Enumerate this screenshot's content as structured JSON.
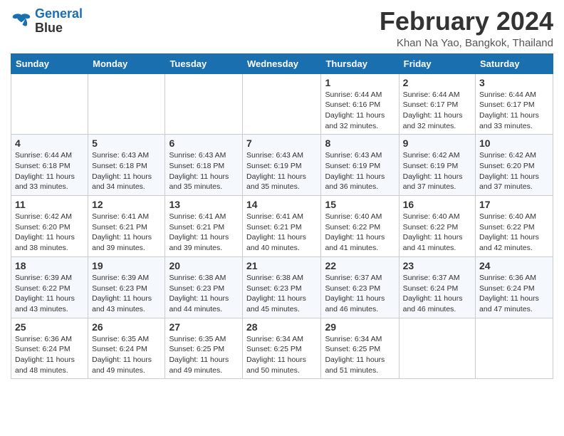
{
  "header": {
    "logo_line1": "General",
    "logo_line2": "Blue",
    "title": "February 2024",
    "subtitle": "Khan Na Yao, Bangkok, Thailand"
  },
  "days_of_week": [
    "Sunday",
    "Monday",
    "Tuesday",
    "Wednesday",
    "Thursday",
    "Friday",
    "Saturday"
  ],
  "weeks": [
    [
      {
        "day": "",
        "info": ""
      },
      {
        "day": "",
        "info": ""
      },
      {
        "day": "",
        "info": ""
      },
      {
        "day": "",
        "info": ""
      },
      {
        "day": "1",
        "info": "Sunrise: 6:44 AM\nSunset: 6:16 PM\nDaylight: 11 hours and 32 minutes."
      },
      {
        "day": "2",
        "info": "Sunrise: 6:44 AM\nSunset: 6:17 PM\nDaylight: 11 hours and 32 minutes."
      },
      {
        "day": "3",
        "info": "Sunrise: 6:44 AM\nSunset: 6:17 PM\nDaylight: 11 hours and 33 minutes."
      }
    ],
    [
      {
        "day": "4",
        "info": "Sunrise: 6:44 AM\nSunset: 6:18 PM\nDaylight: 11 hours and 33 minutes."
      },
      {
        "day": "5",
        "info": "Sunrise: 6:43 AM\nSunset: 6:18 PM\nDaylight: 11 hours and 34 minutes."
      },
      {
        "day": "6",
        "info": "Sunrise: 6:43 AM\nSunset: 6:18 PM\nDaylight: 11 hours and 35 minutes."
      },
      {
        "day": "7",
        "info": "Sunrise: 6:43 AM\nSunset: 6:19 PM\nDaylight: 11 hours and 35 minutes."
      },
      {
        "day": "8",
        "info": "Sunrise: 6:43 AM\nSunset: 6:19 PM\nDaylight: 11 hours and 36 minutes."
      },
      {
        "day": "9",
        "info": "Sunrise: 6:42 AM\nSunset: 6:19 PM\nDaylight: 11 hours and 37 minutes."
      },
      {
        "day": "10",
        "info": "Sunrise: 6:42 AM\nSunset: 6:20 PM\nDaylight: 11 hours and 37 minutes."
      }
    ],
    [
      {
        "day": "11",
        "info": "Sunrise: 6:42 AM\nSunset: 6:20 PM\nDaylight: 11 hours and 38 minutes."
      },
      {
        "day": "12",
        "info": "Sunrise: 6:41 AM\nSunset: 6:21 PM\nDaylight: 11 hours and 39 minutes."
      },
      {
        "day": "13",
        "info": "Sunrise: 6:41 AM\nSunset: 6:21 PM\nDaylight: 11 hours and 39 minutes."
      },
      {
        "day": "14",
        "info": "Sunrise: 6:41 AM\nSunset: 6:21 PM\nDaylight: 11 hours and 40 minutes."
      },
      {
        "day": "15",
        "info": "Sunrise: 6:40 AM\nSunset: 6:22 PM\nDaylight: 11 hours and 41 minutes."
      },
      {
        "day": "16",
        "info": "Sunrise: 6:40 AM\nSunset: 6:22 PM\nDaylight: 11 hours and 41 minutes."
      },
      {
        "day": "17",
        "info": "Sunrise: 6:40 AM\nSunset: 6:22 PM\nDaylight: 11 hours and 42 minutes."
      }
    ],
    [
      {
        "day": "18",
        "info": "Sunrise: 6:39 AM\nSunset: 6:22 PM\nDaylight: 11 hours and 43 minutes."
      },
      {
        "day": "19",
        "info": "Sunrise: 6:39 AM\nSunset: 6:23 PM\nDaylight: 11 hours and 43 minutes."
      },
      {
        "day": "20",
        "info": "Sunrise: 6:38 AM\nSunset: 6:23 PM\nDaylight: 11 hours and 44 minutes."
      },
      {
        "day": "21",
        "info": "Sunrise: 6:38 AM\nSunset: 6:23 PM\nDaylight: 11 hours and 45 minutes."
      },
      {
        "day": "22",
        "info": "Sunrise: 6:37 AM\nSunset: 6:23 PM\nDaylight: 11 hours and 46 minutes."
      },
      {
        "day": "23",
        "info": "Sunrise: 6:37 AM\nSunset: 6:24 PM\nDaylight: 11 hours and 46 minutes."
      },
      {
        "day": "24",
        "info": "Sunrise: 6:36 AM\nSunset: 6:24 PM\nDaylight: 11 hours and 47 minutes."
      }
    ],
    [
      {
        "day": "25",
        "info": "Sunrise: 6:36 AM\nSunset: 6:24 PM\nDaylight: 11 hours and 48 minutes."
      },
      {
        "day": "26",
        "info": "Sunrise: 6:35 AM\nSunset: 6:24 PM\nDaylight: 11 hours and 49 minutes."
      },
      {
        "day": "27",
        "info": "Sunrise: 6:35 AM\nSunset: 6:25 PM\nDaylight: 11 hours and 49 minutes."
      },
      {
        "day": "28",
        "info": "Sunrise: 6:34 AM\nSunset: 6:25 PM\nDaylight: 11 hours and 50 minutes."
      },
      {
        "day": "29",
        "info": "Sunrise: 6:34 AM\nSunset: 6:25 PM\nDaylight: 11 hours and 51 minutes."
      },
      {
        "day": "",
        "info": ""
      },
      {
        "day": "",
        "info": ""
      }
    ]
  ]
}
